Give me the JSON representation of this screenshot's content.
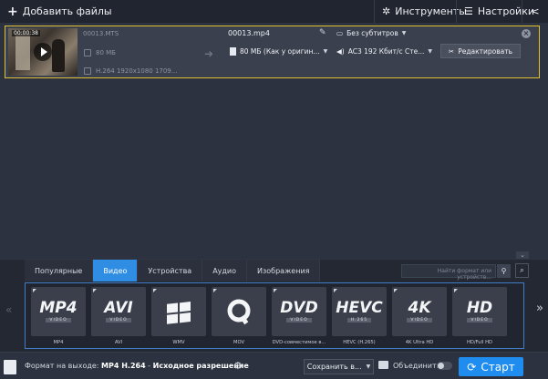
{
  "toolbar": {
    "add_files_label": "Добавить файлы",
    "tools_label": "Инструменты",
    "settings_label": "Настройки"
  },
  "file": {
    "duration": "00:00:38",
    "source_name": "00013.MTS",
    "source_size": "80 МБ",
    "source_codec": "H.264 1920x1080 1709...",
    "output_name": "00013.mp4",
    "output_size": "80 МБ (Как у оригин...",
    "subtitles": "Без субтитров",
    "audio": "AC3 192 Кбит/с Сте...",
    "edit_label": "Редактировать"
  },
  "tabs": [
    {
      "label": "Популярные",
      "active": false
    },
    {
      "label": "Видео",
      "active": true
    },
    {
      "label": "Устройства",
      "active": false
    },
    {
      "label": "Аудио",
      "active": false
    },
    {
      "label": "Изображения",
      "active": false
    }
  ],
  "search": {
    "placeholder": "Найти формат или устройств..."
  },
  "formats": [
    {
      "big": "MP4",
      "sub": "VIDEO",
      "label": "MP4"
    },
    {
      "big": "AVI",
      "sub": "VIDEO",
      "label": "AVI"
    },
    {
      "big": "",
      "sub": "",
      "label": "WMV",
      "icon": "windows-logo-icon"
    },
    {
      "big": "",
      "sub": "",
      "label": "MOV",
      "icon": "quicktime-logo-icon"
    },
    {
      "big": "DVD",
      "sub": "VIDEO",
      "label": "DVD-совместимое в..."
    },
    {
      "big": "HEVC",
      "sub": "H.265",
      "label": "HEVC (H.265)"
    },
    {
      "big": "4K",
      "sub": "VIDEO",
      "label": "4K Ultra HD"
    },
    {
      "big": "HD",
      "sub": "VIDEO",
      "label": "HD/Full HD"
    }
  ],
  "bottom": {
    "format_prefix": "Формат на выходе:",
    "format_value": "MP4 H.264",
    "format_sep": " - ",
    "format_resolution": "Исходное разрешение",
    "save_label": "Сохранить в...",
    "merge_label": "Объединить",
    "start_label": "Старт"
  },
  "colors": {
    "accent": "#1f8cf0",
    "selection_border": "#e0c030"
  }
}
